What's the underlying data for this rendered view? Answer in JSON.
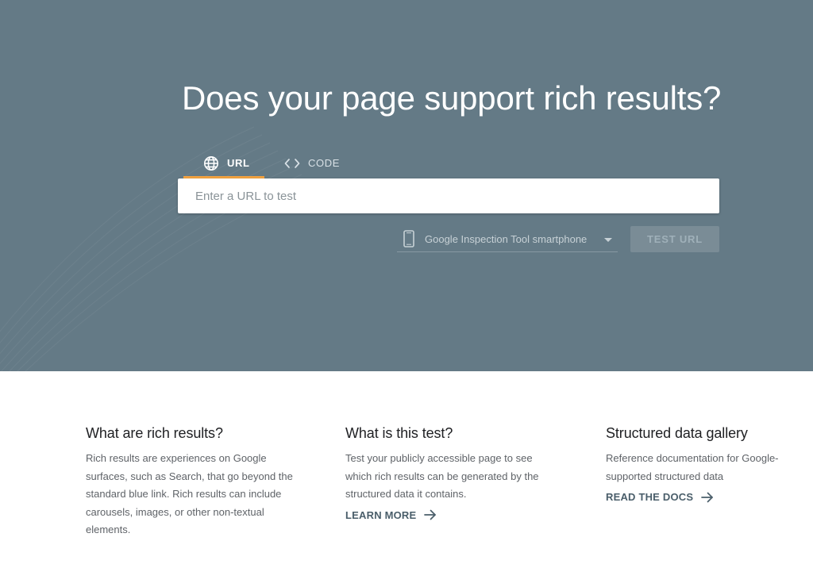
{
  "hero": {
    "headline": "Does your page support rich results?",
    "background_color": "#647a86",
    "accent_color": "#f4a340"
  },
  "tabs": [
    {
      "label": "URL",
      "icon": "globe-icon",
      "selected": true
    },
    {
      "label": "CODE",
      "icon": "code-brackets-icon",
      "selected": false
    }
  ],
  "url_input": {
    "placeholder": "Enter a URL to test",
    "value": ""
  },
  "device_select": {
    "icon": "smartphone-icon",
    "selected": "Google Inspection Tool smartphone"
  },
  "test_button": {
    "label": "TEST URL",
    "enabled": false
  },
  "cards": [
    {
      "title": "What are rich results?",
      "body": "Rich results are experiences on Google surfaces, such as Search, that go beyond the standard blue link. Rich results can include carousels, images, or other non-textual elements."
    },
    {
      "title": "What is this test?",
      "body": "Test your publicly accessible page to see which rich results can be generated by the structured data it contains.",
      "link_label": "LEARN MORE"
    },
    {
      "title": "Structured data gallery",
      "body": "Reference documentation for Google-supported structured data",
      "link_label": "READ THE DOCS"
    }
  ]
}
